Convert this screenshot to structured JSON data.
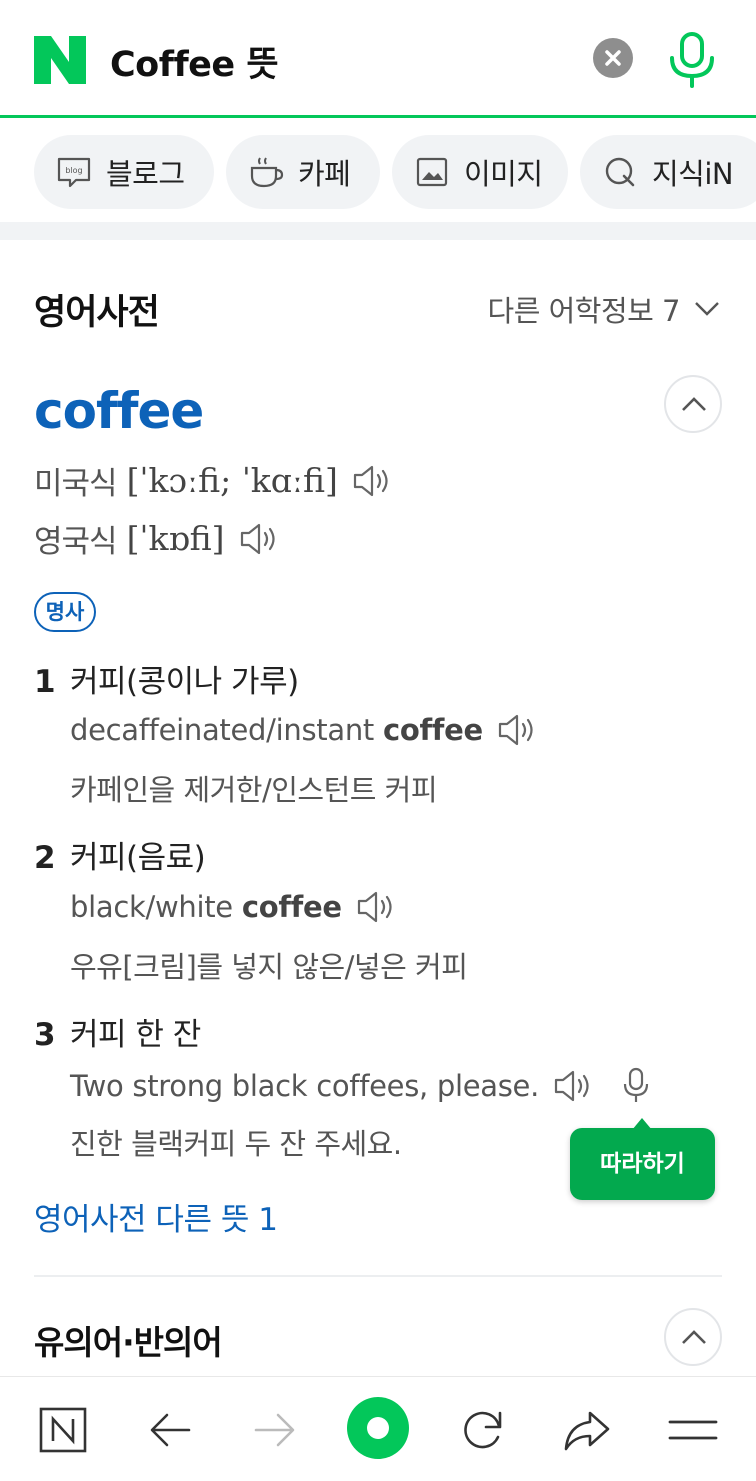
{
  "search": {
    "query": "Coffee 뜻"
  },
  "tabs": [
    {
      "label": "블로그",
      "icon": "blog-icon"
    },
    {
      "label": "카페",
      "icon": "cafe-cup-icon"
    },
    {
      "label": "이미지",
      "icon": "image-icon"
    },
    {
      "label": "지식iN",
      "icon": "knowledge-q-icon"
    }
  ],
  "dictionary": {
    "title": "영어사전",
    "other_info": "다른 어학정보 7",
    "word": "coffee",
    "pronunciations": [
      {
        "region": "미국식",
        "ipa": "[ˈkɔːfi; ˈkɑːfi]"
      },
      {
        "region": "영국식",
        "ipa": "[ˈkɒfi]"
      }
    ],
    "pos": "명사",
    "senses": [
      {
        "num": "1",
        "meaning": "커피(콩이나 가루)",
        "example_plain": "decaffeinated/instant",
        "example_bold": "coffee",
        "translation": "카페인을 제거한/인스턴트 커피"
      },
      {
        "num": "2",
        "meaning": "커피(음료)",
        "example_plain": "black/white",
        "example_bold": "coffee",
        "translation": "우유[크림]를 넣지 않은/넣은 커피"
      },
      {
        "num": "3",
        "meaning": "커피 한 잔",
        "example_plain": "Two strong black coffees, please.",
        "example_bold": "",
        "translation": "진한 블랙커피 두 잔 주세요."
      }
    ],
    "tooltip": "따라하기",
    "more_link": "영어사전 다른 뜻 1"
  },
  "synonyms": {
    "title": "유의어·반의어"
  },
  "colors": {
    "brand_green": "#03c75a",
    "link_blue": "#0d62b8"
  }
}
